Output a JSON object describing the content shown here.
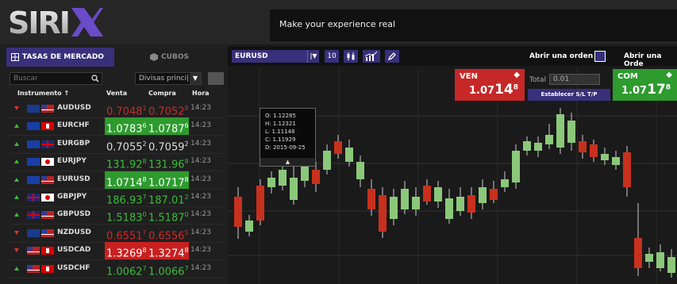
{
  "header": {
    "logo": "SIRIX",
    "slogan": "Make your experience real"
  },
  "left_panel": {
    "tabs": [
      {
        "label": "TASAS DE MERCADO"
      },
      {
        "label": "CUBOS"
      }
    ],
    "search": {
      "placeholder": "Buscar"
    },
    "filter": {
      "value": "Divisas princi|"
    },
    "columns": {
      "instrument": "Instrumento ↑",
      "sell": "Venta",
      "buy": "Compra",
      "time": "Hora"
    },
    "rows": [
      {
        "symbol": "AUDUSD",
        "dir": "down",
        "sell_main": "0.7048",
        "sell_sup": "1",
        "buy_main": "0.7052",
        "buy_sup": "8",
        "time": "14:23",
        "style": "red-text"
      },
      {
        "symbol": "EURCHF",
        "dir": "up",
        "sell_main": "1.0783",
        "sell_sup": "6",
        "buy_main": "1.0787",
        "buy_sup": "6",
        "time": "14:23",
        "style": "green-hl"
      },
      {
        "symbol": "EURGBP",
        "dir": "up",
        "sell_main": "0.7055",
        "sell_sup": "2",
        "buy_main": "0.7059",
        "buy_sup": "2",
        "time": "14:23",
        "style": "none"
      },
      {
        "symbol": "EURJPY",
        "dir": "up",
        "sell_main": "131.92",
        "sell_sup": "8",
        "buy_main": "131.96",
        "buy_sup": "8",
        "time": "14:23",
        "style": "green-text"
      },
      {
        "symbol": "EURUSD",
        "dir": "up",
        "sell_main": "1.0714",
        "sell_sup": "8",
        "buy_main": "1.0717",
        "buy_sup": "8",
        "time": "14:23",
        "style": "green-hl"
      },
      {
        "symbol": "GBPJPY",
        "dir": "up",
        "sell_main": "186.93",
        "sell_sup": "7",
        "buy_main": "187.01",
        "buy_sup": "2",
        "time": "14:23",
        "style": "green-text"
      },
      {
        "symbol": "GBPUSD",
        "dir": "up",
        "sell_main": "1.5183",
        "sell_sup": "0",
        "buy_main": "1.5187",
        "buy_sup": "0",
        "time": "14:23",
        "style": "green-text"
      },
      {
        "symbol": "NZDUSD",
        "dir": "down",
        "sell_main": "0.6551",
        "sell_sup": "7",
        "buy_main": "0.6556",
        "buy_sup": "5",
        "time": "14:23",
        "style": "red-text"
      },
      {
        "symbol": "USDCAD",
        "dir": "down",
        "sell_main": "1.3269",
        "sell_sup": "8",
        "buy_main": "1.3274",
        "buy_sup": "8",
        "time": "14:23",
        "style": "red-hl"
      },
      {
        "symbol": "USDCHF",
        "dir": "up",
        "sell_main": "1.0062",
        "sell_sup": "7",
        "buy_main": "1.0066",
        "buy_sup": "7",
        "time": "14:23",
        "style": "green-text"
      }
    ]
  },
  "chart_panel": {
    "symbol": "EURUSD",
    "timeframe_btn": "10",
    "open_order_label_1": "Abrir una orden",
    "open_order_label_2": "Abrir una Orde",
    "sell": {
      "label": "VEN",
      "price_main": "1.07",
      "price_big": "14",
      "price_sup": "8"
    },
    "buy": {
      "label": "COM",
      "price_main": "1.07",
      "price_big": "17",
      "price_sup": "8"
    },
    "total_label": "Total",
    "total_value": "0.01",
    "sl_tp_button": "Establecer S/L T/P",
    "tooltip": {
      "o": "O:  1.12285",
      "h": "H:  1.12321",
      "l": "L:  1.11148",
      "c": "C:  1.11929",
      "d": "D:  2015-09-25"
    }
  },
  "colors": {
    "accent": "#3a2f7a",
    "up": "#2e9b2e",
    "down": "#c82020"
  }
}
